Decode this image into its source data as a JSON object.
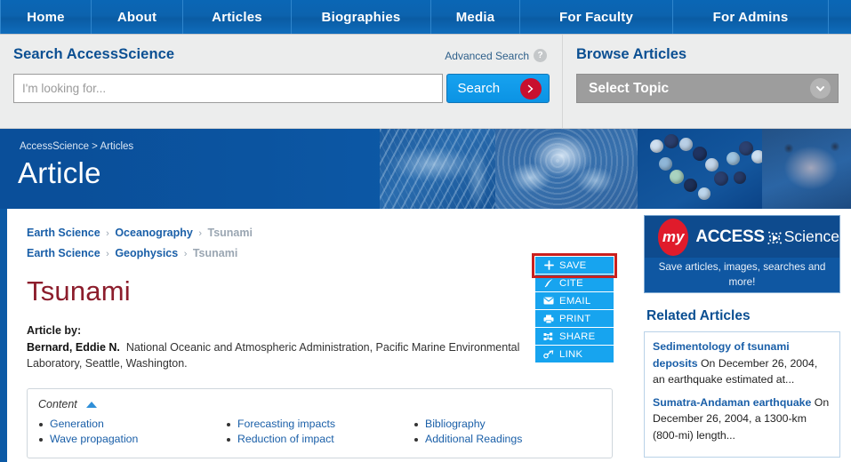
{
  "nav": {
    "items": [
      {
        "label": "Home",
        "width_class": "nav-w-home"
      },
      {
        "label": "About",
        "width_class": "nav-w-about"
      },
      {
        "label": "Articles",
        "width_class": "nav-w-articles"
      },
      {
        "label": "Biographies",
        "width_class": "nav-w-bio"
      },
      {
        "label": "Media",
        "width_class": "nav-w-media"
      },
      {
        "label": "For Faculty",
        "width_class": "nav-w-faculty"
      },
      {
        "label": "For Admins",
        "width_class": "nav-w-admins"
      }
    ]
  },
  "search": {
    "title": "Search AccessScience",
    "advanced_label": "Advanced Search",
    "help_glyph": "?",
    "input_value": "",
    "input_placeholder": "I'm looking for...",
    "button_label": "Search"
  },
  "browse": {
    "title": "Browse Articles",
    "select_label": "Select Topic"
  },
  "hero": {
    "breadcrumb": "AccessScience > Articles",
    "title": "Article"
  },
  "article": {
    "crumbs": [
      {
        "root": "Earth Science",
        "mid": "Oceanography",
        "leaf": "Tsunami"
      },
      {
        "root": "Earth Science",
        "mid": "Geophysics",
        "leaf": "Tsunami"
      }
    ],
    "crumb_separator": "›",
    "title": "Tsunami",
    "byline_label": "Article by:",
    "author": "Bernard, Eddie N.",
    "affiliation": "National Oceanic and Atmospheric Administration, Pacific Marine Environmental Laboratory, Seattle, Washington."
  },
  "actions": {
    "buttons": [
      {
        "label": "SAVE",
        "icon": "plus-icon"
      },
      {
        "label": "CITE",
        "icon": "quill-icon"
      },
      {
        "label": "EMAIL",
        "icon": "envelope-icon"
      },
      {
        "label": "PRINT",
        "icon": "printer-icon"
      },
      {
        "label": "SHARE",
        "icon": "share-nodes-icon"
      },
      {
        "label": "LINK",
        "icon": "chain-link-icon"
      }
    ],
    "highlighted": "SAVE",
    "highlight_color": "#c9201e"
  },
  "content_section": {
    "label": "Content",
    "toggle_icon": "triangle-up-icon",
    "columns": [
      [
        "Generation",
        "Wave propagation"
      ],
      [
        "Forecasting impacts",
        "Reduction of impact"
      ],
      [
        "Bibliography",
        "Additional Readings"
      ]
    ]
  },
  "my_access": {
    "badge_text": "my",
    "wordmark_access": "ACCESS",
    "wordmark_science": "Science",
    "caption": "Save articles, images, searches and more!"
  },
  "related": {
    "title": "Related Articles",
    "items": [
      {
        "link": "Sedimentology of tsunami deposits",
        "text": " On December 26, 2004, an earthquake estimated at..."
      },
      {
        "link": "Sumatra-Andaman earthquake",
        "text": " On December 26, 2004, a 1300-km (800-mi) length..."
      }
    ]
  },
  "colors": {
    "nav_blue": "#0c63ae",
    "accent_blue": "#17a4ef",
    "title_maroon": "#8c1d2c",
    "link_blue": "#1a5fa8",
    "red_badge": "#e01b2b"
  }
}
